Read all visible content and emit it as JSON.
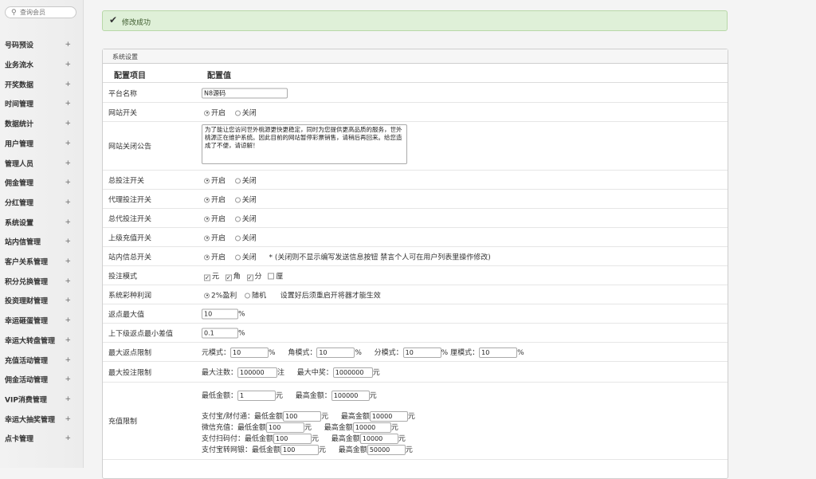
{
  "sidebar": {
    "search_placeholder": "查询会员",
    "items": [
      {
        "label": "号码预设"
      },
      {
        "label": "业务流水"
      },
      {
        "label": "开奖数据"
      },
      {
        "label": "时间管理"
      },
      {
        "label": "数据统计"
      },
      {
        "label": "用户管理"
      },
      {
        "label": "管理人员"
      },
      {
        "label": "佣金管理"
      },
      {
        "label": "分红管理"
      },
      {
        "label": "系统设置"
      },
      {
        "label": "站内信管理"
      },
      {
        "label": "客户关系管理"
      },
      {
        "label": "积分兑换管理"
      },
      {
        "label": "投资理财管理"
      },
      {
        "label": "幸运砸蛋管理"
      },
      {
        "label": "幸运大转盘管理"
      },
      {
        "label": "充值活动管理"
      },
      {
        "label": "佣金活动管理"
      },
      {
        "label": "VIP消费管理"
      },
      {
        "label": "幸运大抽奖管理"
      },
      {
        "label": "点卡管理"
      }
    ],
    "expand_symbol": "+"
  },
  "alert": {
    "icon": "check-icon",
    "message": "修改成功"
  },
  "panel": {
    "title": "系统设置",
    "col_key": "配置项目",
    "col_value": "配置值",
    "platform_name": {
      "label": "平台名称",
      "value": "N8源码"
    },
    "site_switch": {
      "label": "网站开关",
      "on": "开启",
      "off": "关闭",
      "selected": "on"
    },
    "close_notice": {
      "label": "网站关闭公告",
      "value": "为了能让您访问世外桃源更快更稳定，同时为您提供更高品质的服务，世外桃源正在维护系统。因此目前的网站暂停彩票销售，请稍后再回来。给您造成了不便，请谅解！"
    },
    "bet_switch": {
      "label": "总投注开关",
      "on": "开启",
      "off": "关闭",
      "selected": "on"
    },
    "agent_bet_switch": {
      "label": "代理投注开关",
      "on": "开启",
      "off": "关闭",
      "selected": "on"
    },
    "general_agent_bet_switch": {
      "label": "总代投注开关",
      "on": "开启",
      "off": "关闭",
      "selected": "on"
    },
    "parent_recharge_switch": {
      "label": "上级充值开关",
      "on": "开启",
      "off": "关闭",
      "selected": "on"
    },
    "message_switch": {
      "label": "站内信总开关",
      "on": "开启",
      "off": "关闭",
      "selected": "on",
      "note": "* (关闭则不显示编写发送信息按钮 禁言个人可在用户列表里操作修改)"
    },
    "bet_mode": {
      "label": "投注模式",
      "options": [
        "元",
        "角",
        "分",
        "厘"
      ],
      "checked": [
        true,
        true,
        true,
        false
      ]
    },
    "profit_mode": {
      "label": "系统彩种利润",
      "options": [
        "2%盈利",
        "随机"
      ],
      "selected": 0,
      "note": "设置好后须重启开将器才能生效"
    },
    "max_rebate": {
      "label": "返点最大值",
      "value": "10",
      "unit": "%"
    },
    "min_rebate_diff": {
      "label": "上下级返点最小差值",
      "value": "0.1",
      "unit": "%"
    },
    "max_rebate_limit": {
      "label": "最大返点限制",
      "modes": [
        {
          "name": "元模式：",
          "value": "10",
          "unit": "%"
        },
        {
          "name": "角模式：",
          "value": "10",
          "unit": "%"
        },
        {
          "name": "分模式：",
          "value": "10",
          "unit": "%"
        },
        {
          "name": "厘模式：",
          "value": "10",
          "unit": "%"
        }
      ]
    },
    "max_bet_limit": {
      "label": "最大投注限制",
      "max_bets_label": "最大注数：",
      "max_bets": "100000",
      "max_bets_unit": "注",
      "max_prize_label": "最大中奖：",
      "max_prize": "1000000",
      "max_prize_unit": "元"
    },
    "recharge_limit": {
      "label": "充值限制",
      "general": {
        "min_label": "最低金额：",
        "min": "1",
        "min_unit": "元",
        "max_label": "最高金额：",
        "max": "100000",
        "max_unit": "元"
      },
      "channels": [
        {
          "name": "支付宝/财付通：",
          "min_label": "最低金额",
          "min": "100",
          "max_label": "最高金额",
          "max": "10000",
          "unit": "元"
        },
        {
          "name": "微信充值：",
          "min_label": "最低金额",
          "min": "100",
          "max_label": "最高金额",
          "max": "10000",
          "unit": "元"
        },
        {
          "name": "支付扫码付：",
          "min_label": "最低金额",
          "min": "100",
          "max_label": "最高金额",
          "max": "10000",
          "unit": "元"
        },
        {
          "name": "支付宝转网银：",
          "min_label": "最低金额",
          "min": "100",
          "max_label": "最高金额",
          "max": "50000",
          "unit": "元"
        }
      ]
    }
  }
}
